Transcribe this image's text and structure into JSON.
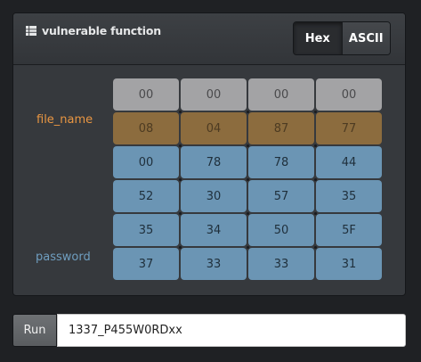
{
  "panel": {
    "title": "vulnerable function",
    "title_icon": "table-icon",
    "toggle": {
      "hex_label": "Hex",
      "ascii_label": "ASCII",
      "selected": "Hex"
    }
  },
  "labels": {
    "file_name": "file_name",
    "password": "password"
  },
  "memory": {
    "rows": [
      {
        "kind": "grey",
        "cells": [
          "00",
          "00",
          "00",
          "00"
        ]
      },
      {
        "kind": "brown",
        "cells": [
          "08",
          "04",
          "87",
          "77"
        ]
      },
      {
        "kind": "blue",
        "cells": [
          "00",
          "78",
          "78",
          "44"
        ]
      },
      {
        "kind": "blue",
        "cells": [
          "52",
          "30",
          "57",
          "35"
        ]
      },
      {
        "kind": "blue",
        "cells": [
          "35",
          "34",
          "50",
          "5F"
        ]
      },
      {
        "kind": "blue",
        "cells": [
          "37",
          "33",
          "33",
          "31"
        ]
      }
    ]
  },
  "run": {
    "label": "Run",
    "input_value": "1337_P455W0RDxx"
  },
  "colors": {
    "file_name": "#e99642",
    "password": "#6f9ec0",
    "grey": "#a3a3a5",
    "brown": "#8c6c3e",
    "blue": "#6b95b4"
  }
}
